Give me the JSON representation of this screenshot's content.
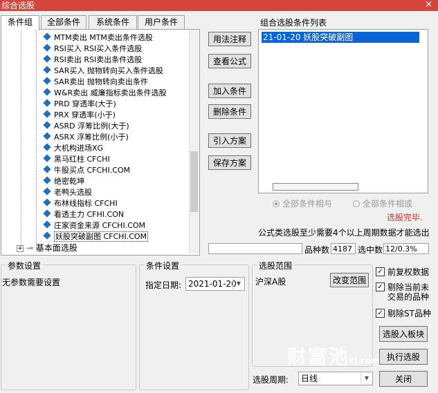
{
  "window": {
    "title": "综合选股",
    "close": "×"
  },
  "tabs": [
    "条件组",
    "全部条件",
    "系统条件",
    "用户条件"
  ],
  "tree": {
    "items": [
      "MTM卖出 MTM卖出条件选股",
      "RSI买入 RSI买入条件选股",
      "RSI卖出 RSI卖出条件选股",
      "SAR买入 抛物转向买入条件选股",
      "SAR卖出 抛物转向卖出条件",
      "W&R卖出 威廉指标卖出条件选股",
      "PRD 穿透率(大于)",
      "PRX 穿透率(小于)",
      "ASRD 浮筹比例(大于)",
      "ASRX 浮筹比例(小于)",
      "大机构进场XG",
      "黑马红柱 CFCHI",
      "牛股买点 CFCHI.COM",
      "绝密乾坤",
      "老鸭头选股",
      "布林线指标 CFCHI",
      "看透主力 CFHI.CON",
      "庄家资金来源 CFCHI.COM",
      "妖股突破副图 CFCHI.COM"
    ],
    "group_node": "基本面选股"
  },
  "buttons": {
    "usage": "用法注释",
    "formula": "查看公式",
    "add": "加入条件",
    "delete": "删除条件",
    "import": "引入方案",
    "save": "保存方案",
    "change_range": "改变范围",
    "to_block": "选股入板块",
    "execute": "执行选股",
    "close": "关闭"
  },
  "cond_list": {
    "label": "组合选股条件列表",
    "items": [
      "21-01-20 妖股突破副图"
    ]
  },
  "radios": {
    "and": "全部条件相与",
    "or": "全部条件相或"
  },
  "status": {
    "done": "选股完毕.",
    "note": "公式类选股至少需要4个以上周期数据才能选出",
    "count_label": "品种数",
    "count_value": "4187",
    "selected_label": "选中数",
    "selected_value": "12/0.3%"
  },
  "params": {
    "legend": "参数设置",
    "text": "无参数需要设置"
  },
  "cond_settings": {
    "legend": "条件设置",
    "date_label": "指定日期:",
    "date_value": "2021-01-20"
  },
  "range": {
    "legend": "选股范围",
    "value": "沪深A股"
  },
  "checks": {
    "fq": "前复权数据",
    "remove_untraded": "剔除当前未交易的品种",
    "remove_st": "剔除ST品种"
  },
  "period": {
    "label": "选股周期:",
    "value": "日线"
  },
  "watermark": {
    "text": "财富池",
    "suffix": "ci.com"
  },
  "colors": {
    "title_bg": "#d4453d",
    "selection": "#0a64d7",
    "done_red": "#e03030",
    "tree_icon": "#1e6fbf"
  }
}
